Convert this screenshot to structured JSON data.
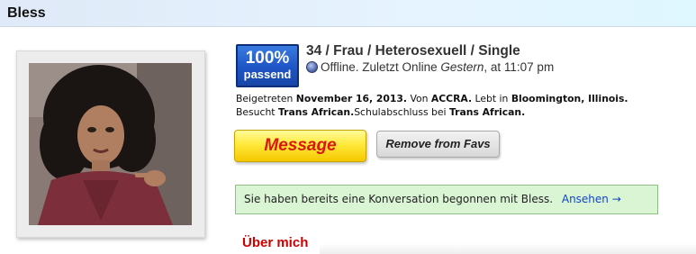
{
  "profile": {
    "name": "Bless",
    "photo_alt": "profile-photo"
  },
  "match": {
    "percent": "100%",
    "label": "passend"
  },
  "summary": "34 / Frau / Heterosexuell / Single",
  "status": {
    "state": "Offline.",
    "last_online_prefix": "Zuletzt Online",
    "last_online_day": "Gestern",
    "last_online_time": ", at 11:07 pm"
  },
  "details": {
    "joined_label": "Beigetreten",
    "joined_date": "November 16, 2013.",
    "from_label": "Von",
    "from_value": "ACCRA.",
    "lives_label": "Lebt in",
    "lives_value": "Bloomington, Illinois.",
    "church_label": "Besucht",
    "church_value": "Trans African.",
    "school_label": "Schulabschluss bei",
    "school_value": "Trans African."
  },
  "buttons": {
    "message": "Message",
    "remove_fav": "Remove from Favs"
  },
  "notice": {
    "text": "Sie haben bereits eine Konversation begonnen mit Bless.",
    "link": "Ansehen →"
  },
  "section": {
    "about": "Über mich"
  },
  "colors": {
    "match_badge": "#1e55c5",
    "message_button": "#ffe93a",
    "notice_bg": "#d9f5d4",
    "section_heading": "#cc0000",
    "link": "#1144cc"
  },
  "icons": {
    "status": "offline-status-icon"
  }
}
